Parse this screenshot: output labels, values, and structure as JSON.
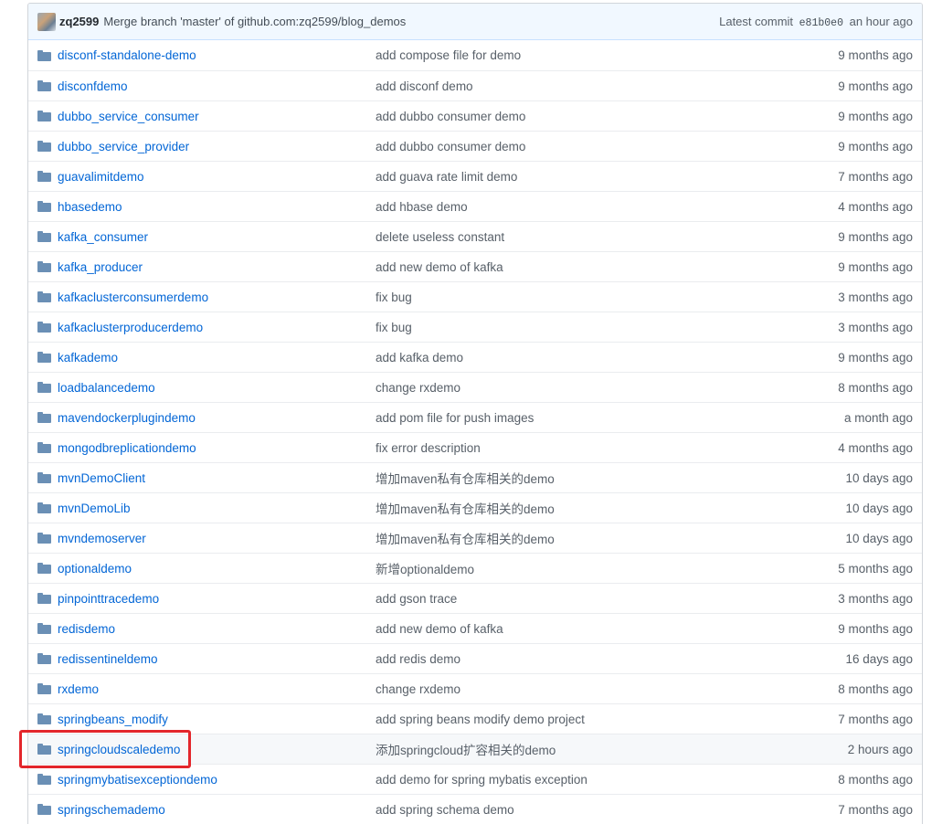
{
  "commit": {
    "author": "zq2599",
    "message": "Merge branch 'master' of github.com:zq2599/blog_demos",
    "latest_label": "Latest commit",
    "sha": "e81b0e0",
    "time": "an hour ago"
  },
  "files": [
    {
      "name": "disconf-standalone-demo",
      "message": "add compose file for demo",
      "age": "9 months ago"
    },
    {
      "name": "disconfdemo",
      "message": "add disconf demo",
      "age": "9 months ago"
    },
    {
      "name": "dubbo_service_consumer",
      "message": "add dubbo consumer demo",
      "age": "9 months ago"
    },
    {
      "name": "dubbo_service_provider",
      "message": "add dubbo consumer demo",
      "age": "9 months ago"
    },
    {
      "name": "guavalimitdemo",
      "message": "add guava rate limit demo",
      "age": "7 months ago"
    },
    {
      "name": "hbasedemo",
      "message": "add hbase demo",
      "age": "4 months ago"
    },
    {
      "name": "kafka_consumer",
      "message": "delete useless constant",
      "age": "9 months ago"
    },
    {
      "name": "kafka_producer",
      "message": "add new demo of kafka",
      "age": "9 months ago"
    },
    {
      "name": "kafkaclusterconsumerdemo",
      "message": "fix bug",
      "age": "3 months ago"
    },
    {
      "name": "kafkaclusterproducerdemo",
      "message": "fix bug",
      "age": "3 months ago"
    },
    {
      "name": "kafkademo",
      "message": "add kafka demo",
      "age": "9 months ago"
    },
    {
      "name": "loadbalancedemo",
      "message": "change rxdemo",
      "age": "8 months ago"
    },
    {
      "name": "mavendockerplugindemo",
      "message": "add pom file for push images",
      "age": "a month ago"
    },
    {
      "name": "mongodbreplicationdemo",
      "message": "fix error description",
      "age": "4 months ago"
    },
    {
      "name": "mvnDemoClient",
      "message": "增加maven私有仓库相关的demo",
      "age": "10 days ago"
    },
    {
      "name": "mvnDemoLib",
      "message": "增加maven私有仓库相关的demo",
      "age": "10 days ago"
    },
    {
      "name": "mvndemoserver",
      "message": "增加maven私有仓库相关的demo",
      "age": "10 days ago"
    },
    {
      "name": "optionaldemo",
      "message": "新增optionaldemo",
      "age": "5 months ago"
    },
    {
      "name": "pinpointtracedemo",
      "message": "add gson trace",
      "age": "3 months ago"
    },
    {
      "name": "redisdemo",
      "message": "add new demo of kafka",
      "age": "9 months ago"
    },
    {
      "name": "redissentineldemo",
      "message": "add redis demo",
      "age": "16 days ago"
    },
    {
      "name": "rxdemo",
      "message": "change rxdemo",
      "age": "8 months ago"
    },
    {
      "name": "springbeans_modify",
      "message": "add spring beans modify demo project",
      "age": "7 months ago"
    },
    {
      "name": "springcloudscaledemo",
      "message": "添加springcloud扩容相关的demo",
      "age": "2 hours ago"
    },
    {
      "name": "springmybatisexceptiondemo",
      "message": "add demo for spring mybatis exception",
      "age": "8 months ago"
    },
    {
      "name": "springschemademo",
      "message": "add spring schema demo",
      "age": "7 months ago"
    }
  ],
  "highlight_color": "#e3262b",
  "link_color": "#0366d6"
}
